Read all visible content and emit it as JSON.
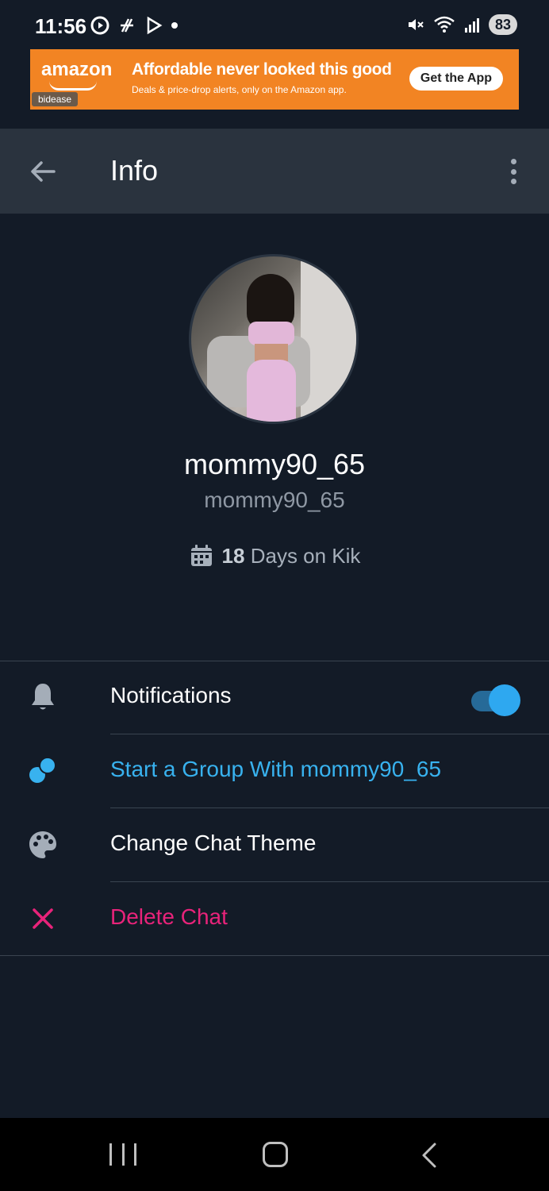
{
  "status_bar": {
    "time": "11:56",
    "battery": "83",
    "left_icons": [
      "record-icon",
      "slack-icon",
      "play-store-icon",
      "dot-icon"
    ],
    "right_icons": [
      "mute-icon",
      "wifi-icon",
      "signal-icon"
    ]
  },
  "ad": {
    "brand": "amazon",
    "sponsor": "bidease",
    "headline": "Affordable never looked this good",
    "subtext": "Deals & price-drop alerts, only on the Amazon app.",
    "cta": "Get the App",
    "background_color": "#f28423"
  },
  "app_bar": {
    "title": "Info",
    "back_icon": "arrow-left-icon",
    "more_icon": "more-vert-icon"
  },
  "profile": {
    "display_name": "mommy90_65",
    "username": "mommy90_65",
    "days_count": "18",
    "days_label": "Days on Kik",
    "days_icon": "calendar-icon"
  },
  "settings": {
    "notifications": {
      "label": "Notifications",
      "icon": "bell-icon",
      "enabled": true
    },
    "start_group": {
      "label": "Start a Group With mommy90_65",
      "icon": "group-icon"
    },
    "change_theme": {
      "label": "Change Chat Theme",
      "icon": "palette-icon"
    },
    "delete_chat": {
      "label": "Delete Chat",
      "icon": "close-icon"
    }
  },
  "colors": {
    "background": "#131b27",
    "app_bar": "#2a333e",
    "accent_blue": "#38b2ef",
    "danger_pink": "#e8237a",
    "toggle_on": "#2ea8f0"
  },
  "nav_bar": {
    "recents_icon": "recents-icon",
    "home_icon": "home-icon",
    "back_icon": "nav-back-icon"
  }
}
